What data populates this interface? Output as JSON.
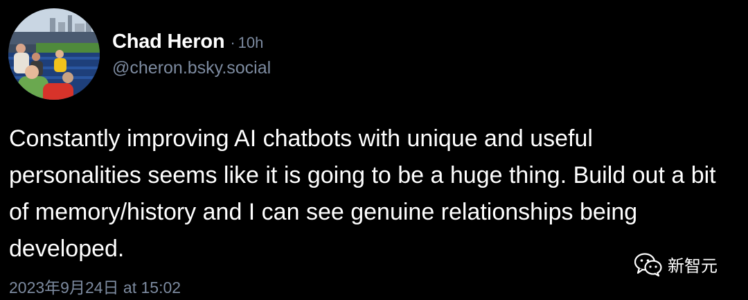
{
  "post": {
    "author": {
      "display_name": "Chad Heron",
      "separator": "·",
      "age": "10h",
      "handle": "@cheron.bsky.social"
    },
    "text": "Constantly improving AI chatbots with unique and useful personalities seems like it is going to be a huge thing. Build out a bit of memory/history and I can see genuine relationships being developed.",
    "timestamp": "2023年9月24日 at 15:02"
  },
  "watermark": {
    "text": "新智元",
    "icon": "wechat-icon"
  },
  "colors": {
    "background": "#000000",
    "primary_text": "#ffffff",
    "secondary_text": "#7d8ba0"
  }
}
